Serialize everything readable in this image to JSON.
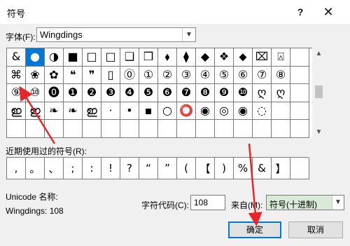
{
  "window": {
    "title": "符号",
    "help_icon": "help-icon",
    "close_icon": "close-icon"
  },
  "font": {
    "label": "字体(F):",
    "value": "Wingdings"
  },
  "symbol_grid": {
    "rows": [
      [
        "&",
        "●",
        "◑",
        "■",
        "□",
        "□",
        "❑",
        "❒",
        "⬧",
        "⧫",
        "◆",
        "❖",
        "⬥",
        "⌧",
        "⍓",
        ""
      ],
      [
        "⌘",
        "❀",
        "✿",
        "❝",
        "❞",
        "▯",
        "⓪",
        "①",
        "②",
        "③",
        "④",
        "⑤",
        "⑥",
        "⑦",
        "⑧",
        ""
      ],
      [
        "⑨",
        "⑩",
        "⓿",
        "❶",
        "❷",
        "❸",
        "❹",
        "❺",
        "❻",
        "❼",
        "❽",
        "❾",
        "❿",
        "ღ",
        "ღ",
        ""
      ],
      [
        "ഇ",
        "ഇ",
        "❧",
        "❧",
        "ഇ",
        "·",
        "•",
        "▪",
        "○",
        "⭕",
        "◉",
        "◎",
        "◉",
        "◌",
        "",
        ""
      ],
      [
        "",
        "",
        "",
        "",
        "",
        "",
        "",
        "",
        "",
        "",
        "",
        "",
        "",
        "",
        "",
        ""
      ]
    ],
    "selected": {
      "row": 0,
      "col": 1
    }
  },
  "recent": {
    "label": "近期使用过的符号(R):",
    "items": [
      ",",
      "。",
      "、",
      ";",
      ":",
      "!",
      "?",
      "“",
      "”",
      "(",
      "【",
      ")",
      "%",
      "&",
      "】",
      ""
    ]
  },
  "unicode": {
    "name_label": "Unicode 名称:",
    "name_value": "Wingdings: 108"
  },
  "char_code": {
    "label": "字符代码(C):",
    "value": "108"
  },
  "from": {
    "label": "来自(M):",
    "value": "符号(十进制)"
  },
  "buttons": {
    "ok": "确定",
    "cancel": "取消"
  },
  "accent_color": "#0078d7",
  "arrow_color": "#e8262a"
}
